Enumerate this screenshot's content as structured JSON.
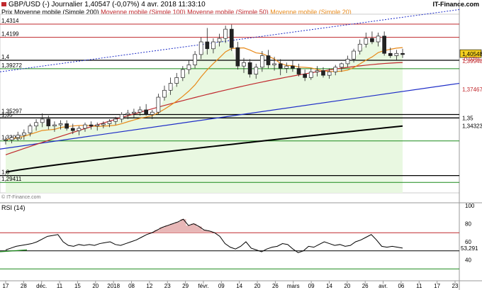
{
  "header": {
    "title": "GBP/USD (-)   Journalier   1,40547 (-0,07%)   4 avr. 2018 11:33:10",
    "brand": "IT-Finance.com",
    "legend": [
      {
        "text": "Prix",
        "color": "#000000"
      },
      {
        "text": "Moyenne mobile (Simple 200)",
        "color": "#000000"
      },
      {
        "text": "Moyenne mobile (Simple 100)",
        "color": "#c0282d"
      },
      {
        "text": "Moyenne mobile (Simple 50)",
        "color": "#c0282d"
      },
      {
        "text": "Moyenne mobile (Simple 20)",
        "color": "#e88a1a"
      }
    ]
  },
  "chart_data": [
    {
      "type": "candlestick",
      "x_ticks": [
        "17",
        "28",
        "déc.",
        "11",
        "15",
        "20",
        "2018",
        "08",
        "12",
        "23",
        "29",
        "févr.",
        "09",
        "14",
        "20",
        "26",
        "mars",
        "09",
        "14",
        "20",
        "26",
        "avr.",
        "06",
        "11",
        "17",
        "23"
      ],
      "ylim": [
        1.285,
        1.44
      ],
      "y_levels_left": [
        {
          "value": 1.4314,
          "label": "1,4314",
          "color": "#000000",
          "line": "#c0282d"
        },
        {
          "value": 1.4199,
          "label": "1,4199",
          "color": "#000000",
          "line": "#c0282d"
        },
        {
          "value": 1.4,
          "label": "1,4",
          "color": "#000000",
          "line": "#000000"
        },
        {
          "value": 1.39272,
          "label": "1,39272",
          "color": "#000000",
          "line": "#1a8a1a"
        },
        {
          "value": 1.35297,
          "label": "1,35297",
          "color": "#000000",
          "line": "#000000"
        },
        {
          "value": 1.35,
          "label": "1,35",
          "color": "#000000",
          "line": "#000000"
        },
        {
          "value": 1.33006,
          "label": "1,33006",
          "color": "#000000",
          "line": "#1a8a1a"
        },
        {
          "value": 1.3,
          "label": "1,3",
          "color": "#000000",
          "line": "#000000"
        },
        {
          "value": 1.29411,
          "label": "1,29411",
          "color": "#000000",
          "line": "#1a8a1a"
        }
      ],
      "y_labels_right": [
        {
          "value": 1.40548,
          "label": "1,40548",
          "box": true
        },
        {
          "value": 1.4012,
          "label": "-0,07%",
          "color": "#c0282d"
        },
        {
          "value": 1.39948,
          "label": "1,39948",
          "color": "#c0282d"
        },
        {
          "value": 1.35,
          "label": "1,35"
        },
        {
          "value": 1.37467,
          "label": "1,37467",
          "color": "#c0282d"
        },
        {
          "value": 1.34323,
          "label": "1,34323"
        }
      ],
      "candles": [
        [
          1.3305,
          1.334,
          1.327,
          1.331
        ],
        [
          1.331,
          1.335,
          1.328,
          1.333
        ],
        [
          1.333,
          1.338,
          1.33,
          1.335
        ],
        [
          1.335,
          1.34,
          1.331,
          1.337
        ],
        [
          1.337,
          1.345,
          1.334,
          1.343
        ],
        [
          1.343,
          1.349,
          1.339,
          1.346
        ],
        [
          1.346,
          1.354,
          1.342,
          1.349
        ],
        [
          1.349,
          1.352,
          1.34,
          1.343
        ],
        [
          1.343,
          1.347,
          1.338,
          1.344
        ],
        [
          1.344,
          1.348,
          1.34,
          1.345
        ],
        [
          1.345,
          1.348,
          1.339,
          1.341
        ],
        [
          1.341,
          1.345,
          1.336,
          1.339
        ],
        [
          1.339,
          1.343,
          1.335,
          1.341
        ],
        [
          1.341,
          1.346,
          1.338,
          1.344
        ],
        [
          1.344,
          1.347,
          1.34,
          1.343
        ],
        [
          1.343,
          1.346,
          1.339,
          1.344
        ],
        [
          1.344,
          1.347,
          1.341,
          1.345
        ],
        [
          1.345,
          1.349,
          1.342,
          1.347
        ],
        [
          1.347,
          1.351,
          1.344,
          1.349
        ],
        [
          1.349,
          1.355,
          1.346,
          1.353
        ],
        [
          1.353,
          1.357,
          1.349,
          1.354
        ],
        [
          1.354,
          1.358,
          1.35,
          1.355
        ],
        [
          1.355,
          1.36,
          1.352,
          1.357
        ],
        [
          1.357,
          1.362,
          1.352,
          1.353
        ],
        [
          1.353,
          1.357,
          1.349,
          1.355
        ],
        [
          1.355,
          1.371,
          1.353,
          1.368
        ],
        [
          1.368,
          1.378,
          1.365,
          1.374
        ],
        [
          1.374,
          1.385,
          1.37,
          1.38
        ],
        [
          1.38,
          1.389,
          1.377,
          1.385
        ],
        [
          1.385,
          1.395,
          1.382,
          1.392
        ],
        [
          1.392,
          1.4,
          1.388,
          1.396
        ],
        [
          1.396,
          1.408,
          1.393,
          1.405
        ],
        [
          1.405,
          1.42,
          1.401,
          1.416
        ],
        [
          1.416,
          1.428,
          1.405,
          1.41
        ],
        [
          1.41,
          1.419,
          1.406,
          1.416
        ],
        [
          1.416,
          1.423,
          1.412,
          1.419
        ],
        [
          1.419,
          1.43,
          1.415,
          1.427
        ],
        [
          1.427,
          1.431,
          1.408,
          1.411
        ],
        [
          1.411,
          1.416,
          1.392,
          1.395
        ],
        [
          1.395,
          1.402,
          1.389,
          1.398
        ],
        [
          1.398,
          1.401,
          1.385,
          1.388
        ],
        [
          1.388,
          1.397,
          1.384,
          1.394
        ],
        [
          1.394,
          1.408,
          1.39,
          1.404
        ],
        [
          1.404,
          1.409,
          1.393,
          1.396
        ],
        [
          1.396,
          1.403,
          1.391,
          1.397
        ],
        [
          1.397,
          1.401,
          1.387,
          1.393
        ],
        [
          1.393,
          1.398,
          1.389,
          1.395
        ],
        [
          1.395,
          1.4,
          1.39,
          1.393
        ],
        [
          1.393,
          1.397,
          1.386,
          1.388
        ],
        [
          1.388,
          1.392,
          1.382,
          1.385
        ],
        [
          1.385,
          1.393,
          1.383,
          1.39
        ],
        [
          1.39,
          1.395,
          1.386,
          1.391
        ],
        [
          1.391,
          1.394,
          1.385,
          1.387
        ],
        [
          1.387,
          1.393,
          1.384,
          1.39
        ],
        [
          1.39,
          1.396,
          1.387,
          1.394
        ],
        [
          1.394,
          1.398,
          1.39,
          1.397
        ],
        [
          1.397,
          1.404,
          1.394,
          1.401
        ],
        [
          1.401,
          1.41,
          1.398,
          1.408
        ],
        [
          1.408,
          1.418,
          1.405,
          1.414
        ],
        [
          1.414,
          1.424,
          1.411,
          1.419
        ],
        [
          1.419,
          1.425,
          1.414,
          1.416
        ],
        [
          1.416,
          1.424,
          1.412,
          1.421
        ],
        [
          1.421,
          1.425,
          1.404,
          1.406
        ],
        [
          1.406,
          1.411,
          1.402,
          1.404
        ],
        [
          1.404,
          1.409,
          1.4,
          1.406
        ],
        [
          1.406,
          1.41,
          1.402,
          1.405
        ]
      ],
      "moving_averages": [
        {
          "name": "Moyenne mobile (Simple 200)",
          "color": "#000000",
          "from": [
            0,
            1.303
          ],
          "to": [
            65,
            1.343
          ]
        },
        {
          "name": "Moyenne mobile (Simple 100)",
          "color": "#c0282d",
          "from": [
            0,
            1.318
          ],
          "to": [
            65,
            1.398
          ]
        },
        {
          "name": "Moyenne mobile (Simple 20)",
          "color": "#e88a1a",
          "from": [
            0,
            1.331
          ],
          "to": [
            65,
            1.404
          ]
        }
      ]
    },
    {
      "type": "line",
      "title": "RSI (14)",
      "ylim": [
        20,
        100
      ],
      "y_ticks": [
        100,
        80,
        60,
        40
      ],
      "levels": [
        70,
        30
      ],
      "last_value": "53,291",
      "values": [
        51,
        53,
        55,
        56,
        57,
        58,
        60,
        63,
        66,
        67,
        68,
        60,
        56,
        55,
        57,
        56,
        57,
        56,
        58,
        59,
        60,
        57,
        56,
        58,
        60,
        62,
        65,
        68,
        70,
        73,
        76,
        78,
        80,
        82,
        85,
        78,
        80,
        77,
        73,
        72,
        70,
        66,
        58,
        54,
        52,
        55,
        60,
        53,
        51,
        49,
        52,
        54,
        55,
        58,
        57,
        52,
        48,
        50,
        55,
        54,
        57,
        60,
        58,
        56,
        57,
        55,
        56,
        60,
        62,
        65,
        68,
        62,
        55,
        54,
        55,
        54,
        53
      ]
    }
  ],
  "watermark": "© IT-Finance.com"
}
